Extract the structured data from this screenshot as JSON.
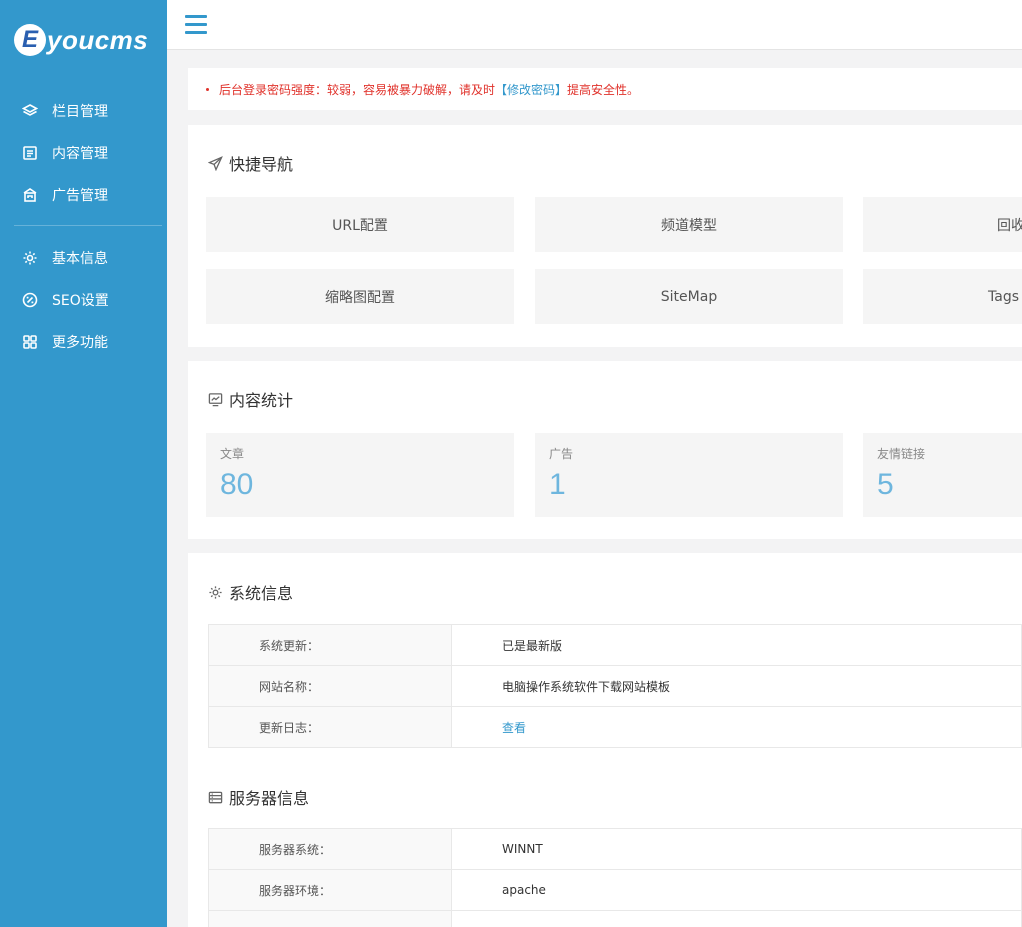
{
  "logo": {
    "badge": "E",
    "text": "youcms"
  },
  "sidebar": {
    "group1": [
      {
        "label": "栏目管理",
        "icon": "layers-icon"
      },
      {
        "label": "内容管理",
        "icon": "document-icon"
      },
      {
        "label": "广告管理",
        "icon": "ad-icon"
      }
    ],
    "group2": [
      {
        "label": "基本信息",
        "icon": "gear-icon"
      },
      {
        "label": "SEO设置",
        "icon": "seo-icon"
      },
      {
        "label": "更多功能",
        "icon": "grid-icon"
      }
    ]
  },
  "alert": {
    "prefix": "后台登录密码强度：较弱，容易被暴力破解，请及时",
    "link": "【修改密码】",
    "suffix": "提高安全性。"
  },
  "quick_nav": {
    "title": "快捷导航",
    "items": [
      "URL配置",
      "频道模型",
      "回收站",
      "缩略图配置",
      "SiteMap",
      "Tags"
    ]
  },
  "stats": {
    "title": "内容统计",
    "items": [
      {
        "label": "文章",
        "value": "80"
      },
      {
        "label": "广告",
        "value": "1"
      },
      {
        "label": "友情链接",
        "value": "5"
      }
    ]
  },
  "system": {
    "title": "系统信息",
    "rows": [
      {
        "key": "系统更新：",
        "value": "已是最新版"
      },
      {
        "key": "网站名称：",
        "value": "电脑操作系统软件下载网站模板"
      },
      {
        "key": "更新日志：",
        "value": "查看"
      }
    ]
  },
  "server": {
    "title": "服务器信息",
    "rows": [
      {
        "key": "服务器系统：",
        "value": "WINNT"
      },
      {
        "key": "服务器环境：",
        "value": "apache"
      },
      {
        "key": "",
        "value": ""
      }
    ]
  },
  "colors": {
    "sidebar": "#3398cc",
    "accent": "#3398cc",
    "alert": "#e0312a",
    "stat_value": "#6eb6de"
  }
}
